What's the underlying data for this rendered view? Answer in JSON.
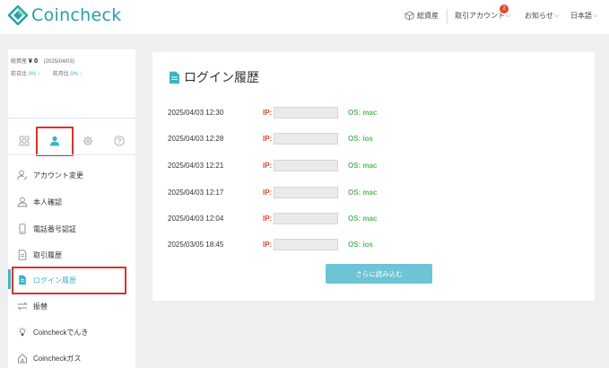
{
  "header": {
    "brand": "Coincheck",
    "total_assets": "総資産",
    "trade_account": "取引アカウント",
    "notification_count": "2",
    "notices": "お知らせ",
    "language": "日本語"
  },
  "sidebar": {
    "total_label": "総資産",
    "total_value": "¥ 0",
    "date": "(2025/04/03)",
    "prev_day_label": "前日比",
    "prev_day_value": "0% ↑",
    "prev_month_label": "前月比",
    "prev_month_value": "0% ↑",
    "menu": [
      {
        "label": "アカウント変更",
        "icon": "user-edit-icon"
      },
      {
        "label": "本人確認",
        "icon": "user-icon"
      },
      {
        "label": "電話番号認証",
        "icon": "phone-icon"
      },
      {
        "label": "取引履歴",
        "icon": "document-icon"
      },
      {
        "label": "ログイン履歴",
        "icon": "document-filled-icon",
        "active": true
      },
      {
        "label": "振替",
        "icon": "transfer-icon"
      },
      {
        "label": "Coincheckでんき",
        "icon": "lightbulb-icon"
      },
      {
        "label": "Coincheckガス",
        "icon": "gas-icon"
      }
    ]
  },
  "main": {
    "title": "ログイン履歴",
    "ip_label": "IP:",
    "rows": [
      {
        "datetime": "2025/04/03 12:30",
        "os": "OS: mac"
      },
      {
        "datetime": "2025/04/03 12:28",
        "os": "OS: ios"
      },
      {
        "datetime": "2025/04/03 12:21",
        "os": "OS: mac"
      },
      {
        "datetime": "2025/04/03 12:17",
        "os": "OS: mac"
      },
      {
        "datetime": "2025/04/03 12:04",
        "os": "OS: mac"
      },
      {
        "datetime": "2025/03/05 18:45",
        "os": "OS: ios"
      }
    ],
    "load_more": "さらに読み込む"
  },
  "colors": {
    "brand": "#24a0a8",
    "accent": "#3fb4c2",
    "ip_label": "#e2462f",
    "os_label": "#5cb85c",
    "highlight_box": "#d9342b"
  }
}
